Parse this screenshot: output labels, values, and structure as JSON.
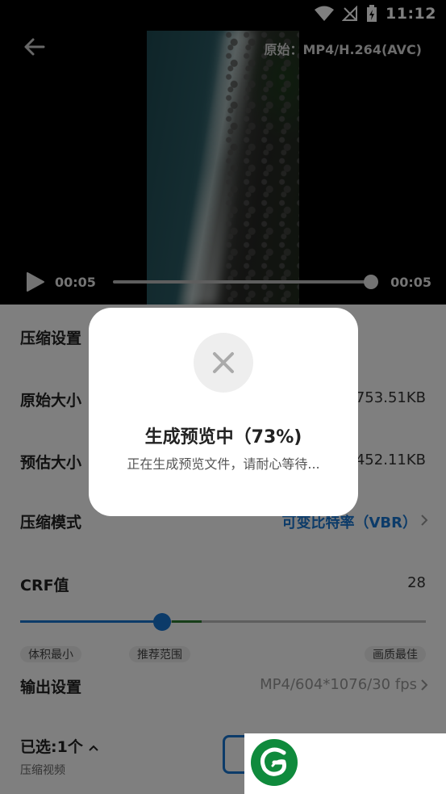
{
  "status_bar": {
    "time": "11:12"
  },
  "video": {
    "format_label": "原始：MP4/H.264(AVC)",
    "time_start": "00:05",
    "time_end": "00:05",
    "progress": 1.0
  },
  "settings": {
    "compress_settings_label": "压缩设置",
    "original_size_label": "原始大小",
    "original_size_value": "753.51KB",
    "estimated_size_label": "预估大小",
    "estimated_size_value": "452.11KB",
    "compress_mode_label": "压缩模式",
    "compress_mode_value": "可变比特率（VBR）",
    "crf_label": "CRF值",
    "crf_value": "28",
    "chip_left": "体积最小",
    "chip_mid": "推荐范围",
    "chip_right": "画质最佳",
    "output_label": "输出设置",
    "output_value": "MP4/604*1076/30 fps"
  },
  "bottom": {
    "selected_label": "已选:1个",
    "selected_sub": "压缩视频"
  },
  "dialog": {
    "title": "生成预览中（73%)",
    "message": "正在生成预览文件，请耐心等待..."
  },
  "colors": {
    "accent": "#1976d2",
    "recommended": "#2e7d32",
    "logo_green": "#0f8a3c"
  },
  "icons": {
    "back": "arrow-left-icon",
    "play": "play-icon",
    "close": "close-icon",
    "chevron": "chevron-right-icon",
    "caret_up": "caret-up-icon"
  }
}
